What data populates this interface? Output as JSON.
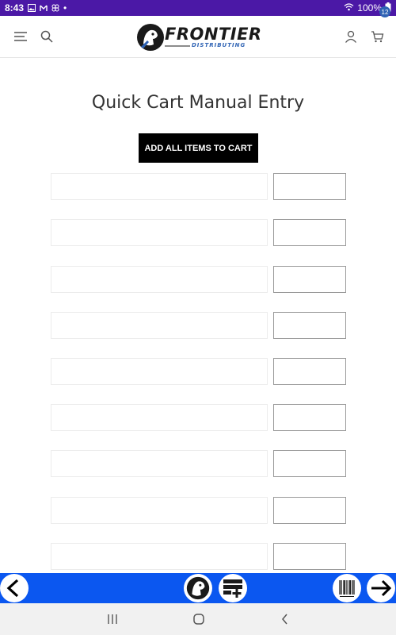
{
  "status_bar": {
    "time": "8:43",
    "battery": "100%",
    "dot": "•"
  },
  "header": {
    "logo_text": "FRONTIER",
    "logo_subtext": "DISTRIBUTING",
    "cart_count": "12",
    "icons": [
      "menu-icon",
      "search-icon",
      "account-icon",
      "cart-icon"
    ]
  },
  "main": {
    "title": "Quick Cart Manual Entry",
    "add_all_label": "ADD ALL ITEMS TO CART",
    "entry_rows": [
      {
        "item": "",
        "qty": ""
      },
      {
        "item": "",
        "qty": ""
      },
      {
        "item": "",
        "qty": ""
      },
      {
        "item": "",
        "qty": ""
      },
      {
        "item": "",
        "qty": ""
      },
      {
        "item": "",
        "qty": ""
      },
      {
        "item": "",
        "qty": ""
      },
      {
        "item": "",
        "qty": ""
      },
      {
        "item": "",
        "qty": ""
      }
    ]
  },
  "bottom_toolbar": {
    "background": "#0b57f0",
    "icons": [
      "back-arrow-icon",
      "mascot-logo-icon",
      "scan-list-icon",
      "barcode-icon",
      "forward-arrow-icon"
    ]
  },
  "system_nav": {
    "icons": [
      "recent-apps-icon",
      "home-icon",
      "back-icon"
    ]
  },
  "colors": {
    "status_bar": "#4b18a6",
    "accent": "#2f63b4",
    "button": "#000000"
  }
}
